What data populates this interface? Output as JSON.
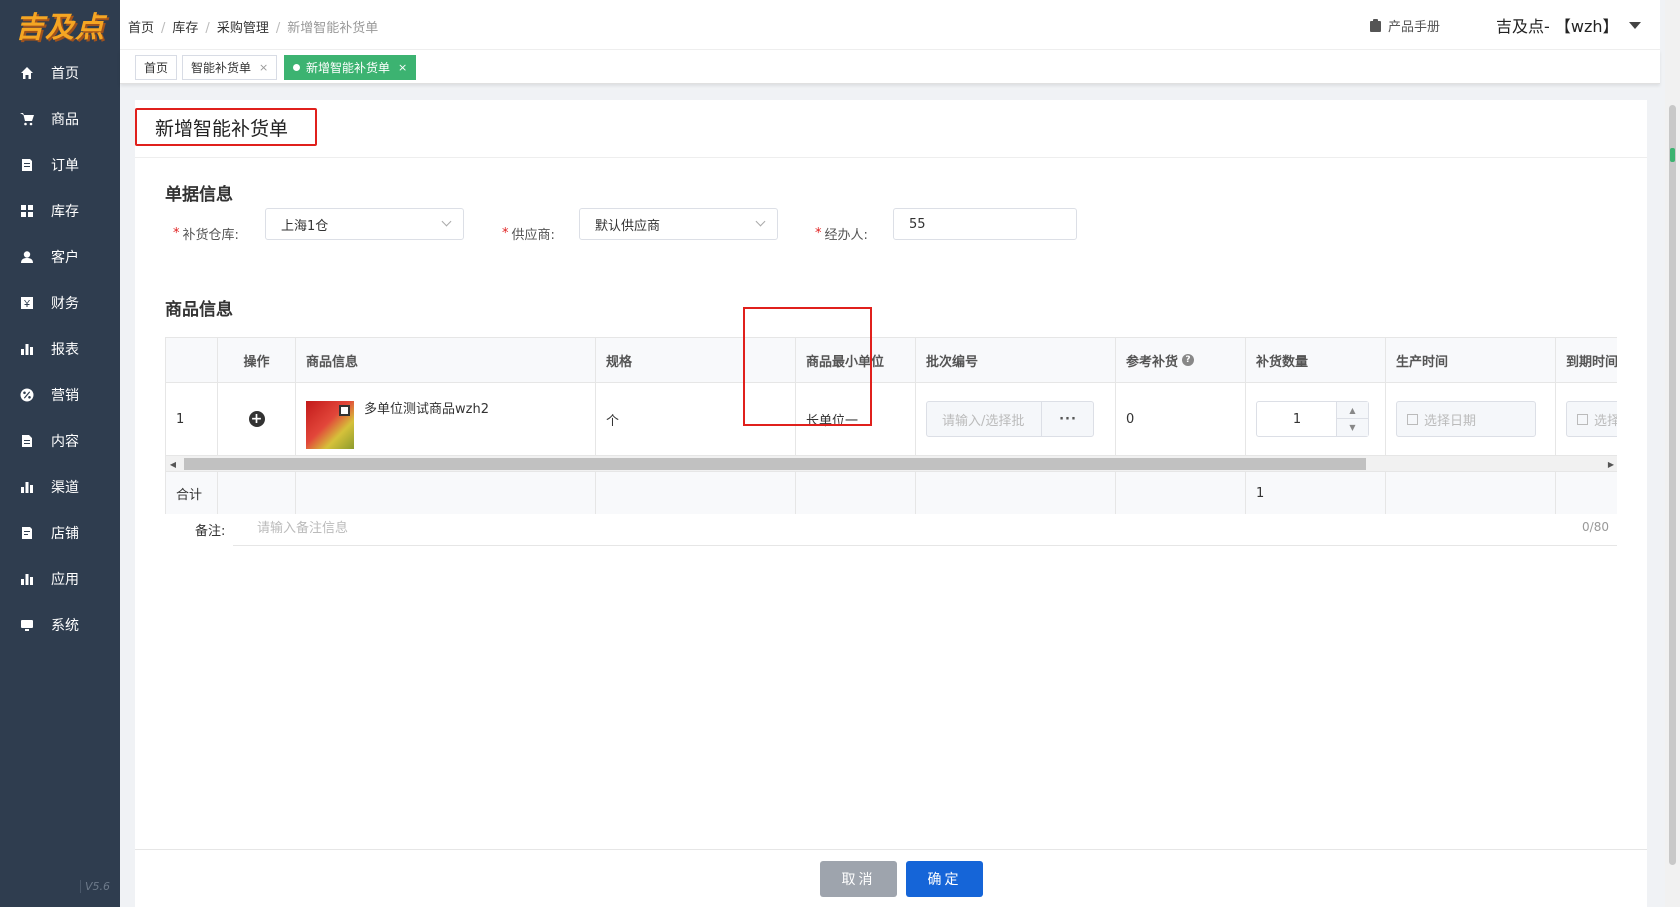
{
  "sidebar": {
    "logo": "吉及点",
    "version": "V5.6",
    "items": [
      {
        "label": "首页",
        "icon": "home-icon"
      },
      {
        "label": "商品",
        "icon": "cart-icon"
      },
      {
        "label": "订单",
        "icon": "order-icon"
      },
      {
        "label": "库存",
        "icon": "grid-icon"
      },
      {
        "label": "客户",
        "icon": "user-icon"
      },
      {
        "label": "财务",
        "icon": "finance-icon"
      },
      {
        "label": "报表",
        "icon": "bar-chart-icon"
      },
      {
        "label": "营销",
        "icon": "percent-icon"
      },
      {
        "label": "内容",
        "icon": "document-icon"
      },
      {
        "label": "渠道",
        "icon": "bar-chart-icon"
      },
      {
        "label": "店铺",
        "icon": "store-icon"
      },
      {
        "label": "应用",
        "icon": "bar-chart-icon"
      },
      {
        "label": "系统",
        "icon": "monitor-icon"
      }
    ]
  },
  "header": {
    "breadcrumb": [
      "首页",
      "库存",
      "采购管理",
      "新增智能补货单"
    ],
    "manual": "产品手册",
    "user": "吉及点- 【wzh】"
  },
  "tabs": [
    {
      "label": "首页",
      "closable": false,
      "active": false
    },
    {
      "label": "智能补货单",
      "closable": true,
      "active": false
    },
    {
      "label": "新增智能补货单",
      "closable": true,
      "active": true
    }
  ],
  "tab_close": "×",
  "page": {
    "title": "新增智能补货单",
    "doc_section": "单据信息",
    "goods_section": "商品信息"
  },
  "form": {
    "warehouse_label": "补货仓库:",
    "warehouse_value": "上海1仓",
    "supplier_label": "供应商:",
    "supplier_value": "默认供应商",
    "handler_label": "经办人:",
    "handler_value": "55",
    "required_mark": "*"
  },
  "table": {
    "headers": [
      "",
      "操作",
      "商品信息",
      "规格",
      "商品最小单位",
      "批次编号",
      "参考补货",
      "补货数量",
      "生产时间",
      "到期时间"
    ],
    "help_icon": "?",
    "row": {
      "index": "1",
      "product_name": "多单位测试商品wzh2",
      "spec": "个",
      "min_unit": "长单位一",
      "batch_placeholder": "请输入/选择批",
      "batch_more": "···",
      "ref_qty": "0",
      "qty": "1",
      "production_placeholder": "选择日期",
      "expiry_placeholder": "选择日期"
    },
    "footer": {
      "label": "合计",
      "qty_total": "1"
    }
  },
  "remark": {
    "label": "备注:",
    "placeholder": "请输入备注信息",
    "count": "0/80"
  },
  "actions": {
    "cancel": "取消",
    "confirm": "确定"
  },
  "colors": {
    "sidebar_bg": "#2f3d4f",
    "active_tab": "#3cb371",
    "primary": "#1565d8",
    "highlight": "#e0201c"
  }
}
